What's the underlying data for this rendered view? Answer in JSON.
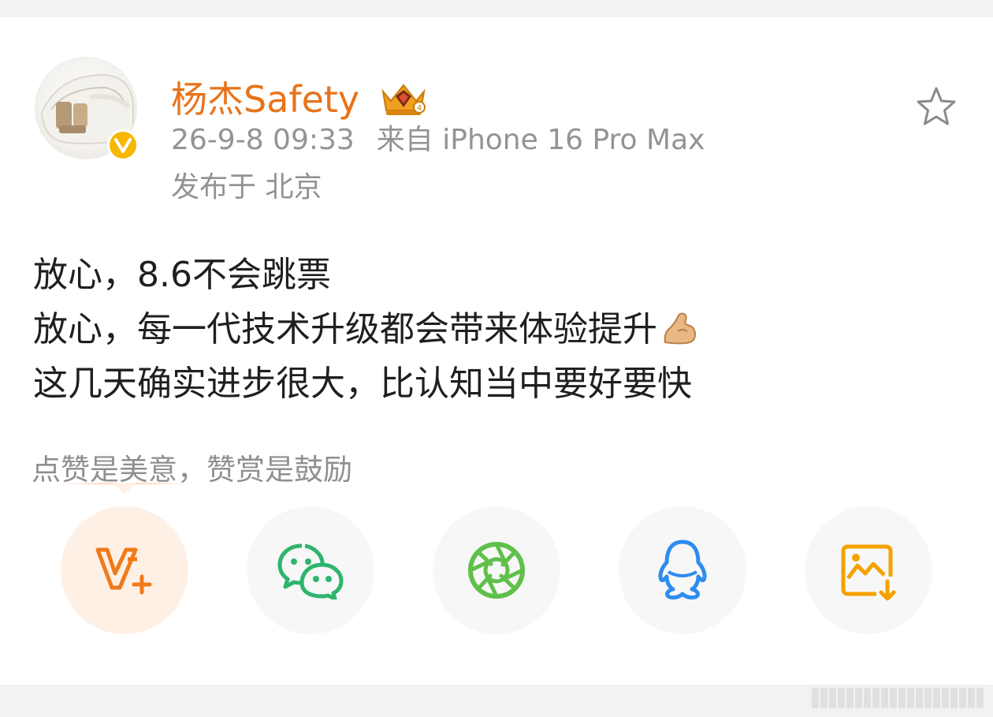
{
  "post": {
    "author": {
      "name": "杨杰Safety",
      "verified_icon": "verified-v-badge",
      "rank_icon": "crown-level-4-icon"
    },
    "meta": {
      "datetime": "26-9-8 09:33",
      "source": "来自 iPhone 16 Pro Max",
      "location": "发布于 北京"
    },
    "content_lines": [
      "放心，8.6不会跳票",
      "放心，每一代技术升级都会带来体验提升",
      "这几天确实进步很大，比认知当中要好要快"
    ],
    "content_emoji": "flexed-biceps-emoji",
    "reward_prompt": "点赞是美意，赞赏是鼓励"
  },
  "share_actions": [
    {
      "name": "weibo-vplus",
      "icon": "v-plus-icon",
      "active": true
    },
    {
      "name": "wechat",
      "icon": "wechat-icon"
    },
    {
      "name": "moments",
      "icon": "moments-aperture-icon"
    },
    {
      "name": "qq",
      "icon": "qq-penguin-icon"
    },
    {
      "name": "save-image",
      "icon": "save-image-icon"
    }
  ],
  "colors": {
    "accent": "#e8731a",
    "meta_text": "#939393",
    "body_text": "#1f1f1f",
    "wechat": "#2fb46e",
    "moments": "#5fc04a",
    "qq": "#2d8cf0",
    "save": "#f5a200",
    "verified": "#f6b800"
  }
}
